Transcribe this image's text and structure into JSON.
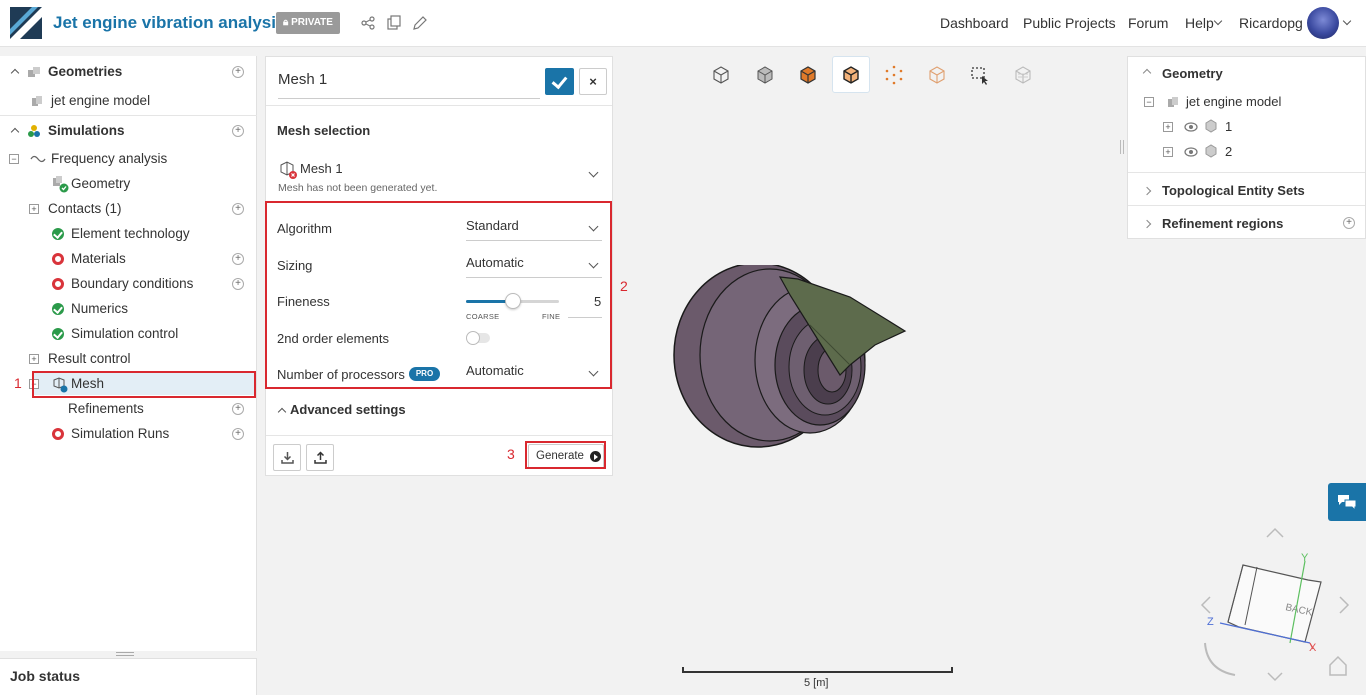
{
  "header": {
    "title": "Jet engine vibration analysis",
    "private_badge": "PRIVATE",
    "nav": [
      "Dashboard",
      "Public Projects",
      "Forum",
      "Help"
    ],
    "user": "Ricardopg"
  },
  "tree": {
    "geometries_label": "Geometries",
    "geometry_item": "jet engine model",
    "simulations_label": "Simulations",
    "analysis": "Frequency analysis",
    "items": {
      "geometry": "Geometry",
      "contacts": "Contacts (1)",
      "element_technology": "Element technology",
      "materials": "Materials",
      "boundary_conditions": "Boundary conditions",
      "numerics": "Numerics",
      "simulation_control": "Simulation control",
      "result_control": "Result control",
      "mesh": "Mesh",
      "refinements": "Refinements",
      "simulation_runs": "Simulation Runs"
    }
  },
  "job_status": "Job status",
  "annotations": {
    "a1": "1",
    "a2": "2",
    "a3": "3"
  },
  "mesh_panel": {
    "name": "Mesh 1",
    "close_label": "×",
    "section": "Mesh selection",
    "selected_mesh": "Mesh 1",
    "mesh_note": "Mesh has not been generated yet.",
    "fields": {
      "algorithm_label": "Algorithm",
      "algorithm_value": "Standard",
      "sizing_label": "Sizing",
      "sizing_value": "Automatic",
      "fineness_label": "Fineness",
      "fineness_value": "5",
      "fineness_fraction": 0.5,
      "coarse": "COARSE",
      "fine": "FINE",
      "second_order_label": "2nd order elements",
      "processors_label": "Number of processors",
      "pro_badge": "PRO",
      "processors_value": "Automatic"
    },
    "advanced": "Advanced settings",
    "generate": "Generate"
  },
  "right_panel": {
    "geometry": "Geometry",
    "model": "jet engine model",
    "parts": [
      "1",
      "2"
    ],
    "topological": "Topological Entity Sets",
    "refinement_regions": "Refinement regions"
  },
  "viewport": {
    "scale_label": "5 [m]",
    "cube_face": "BACK",
    "axis_x": "X",
    "axis_y": "Y",
    "axis_z": "Z"
  },
  "colors": {
    "accent": "#1a74a8",
    "highlight_box": "#d9282f",
    "ok": "#2b9a4a",
    "error": "#d9343b",
    "engine_body": "#6b5a6b",
    "engine_fin": "#5d6b4c"
  }
}
